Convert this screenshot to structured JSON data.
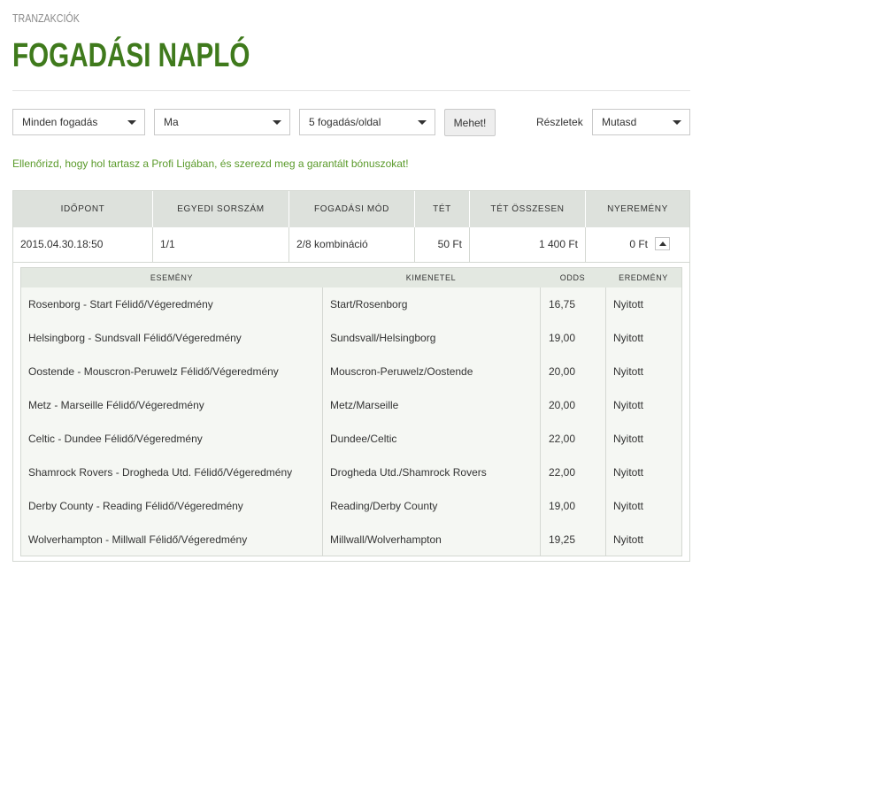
{
  "breadcrumb": "TRANZAKCIÓK",
  "page_title": "FOGADÁSI NAPLÓ",
  "filters": {
    "bet_type": "Minden fogadás",
    "period": "Ma",
    "per_page": "5 fogadás/oldal",
    "go_button": "Mehet!",
    "details_label": "Részletek",
    "details_value": "Mutasd"
  },
  "promo_text": "Ellenőrizd, hogy hol tartasz a Profi Ligában, és szerezd meg a garantált bónuszokat!",
  "table": {
    "headers": [
      "IDŐPONT",
      "EGYEDI SORSZÁM",
      "FOGADÁSI MÓD",
      "TÉT",
      "TÉT ÖSSZESEN",
      "NYEREMÉNY"
    ],
    "row": {
      "time": "2015.04.30.18:50",
      "serial": "1/1",
      "mode": "2/8 kombináció",
      "stake": "50 Ft",
      "total": "1 400 Ft",
      "win": "0 Ft"
    }
  },
  "details": {
    "headers": [
      "ESEMÉNY",
      "KIMENETEL",
      "ODDS",
      "EREDMÉNY"
    ],
    "rows": [
      {
        "event": "Rosenborg - Start Félidő/Végeredmény",
        "outcome": "Start/Rosenborg",
        "odds": "16,75",
        "result": "Nyitott"
      },
      {
        "event": "Helsingborg - Sundsvall Félidő/Végeredmény",
        "outcome": "Sundsvall/Helsingborg",
        "odds": "19,00",
        "result": "Nyitott"
      },
      {
        "event": "Oostende - Mouscron-Peruwelz Félidő/Végeredmény",
        "outcome": "Mouscron-Peruwelz/Oostende",
        "odds": "20,00",
        "result": "Nyitott"
      },
      {
        "event": "Metz - Marseille Félidő/Végeredmény",
        "outcome": "Metz/Marseille",
        "odds": "20,00",
        "result": "Nyitott"
      },
      {
        "event": "Celtic - Dundee Félidő/Végeredmény",
        "outcome": "Dundee/Celtic",
        "odds": "22,00",
        "result": "Nyitott"
      },
      {
        "event": "Shamrock Rovers - Drogheda Utd. Félidő/Végeredmény",
        "outcome": "Drogheda Utd./Shamrock Rovers",
        "odds": "22,00",
        "result": "Nyitott"
      },
      {
        "event": "Derby County - Reading Félidő/Végeredmény",
        "outcome": "Reading/Derby County",
        "odds": "19,00",
        "result": "Nyitott"
      },
      {
        "event": "Wolverhampton - Millwall Félidő/Végeredmény",
        "outcome": "Millwall/Wolverhampton",
        "odds": "19,25",
        "result": "Nyitott"
      }
    ]
  },
  "colors": {
    "title_green": "#3f7a1c",
    "promo_green": "#5a9a2a",
    "header_bg": "#dde1dc"
  }
}
